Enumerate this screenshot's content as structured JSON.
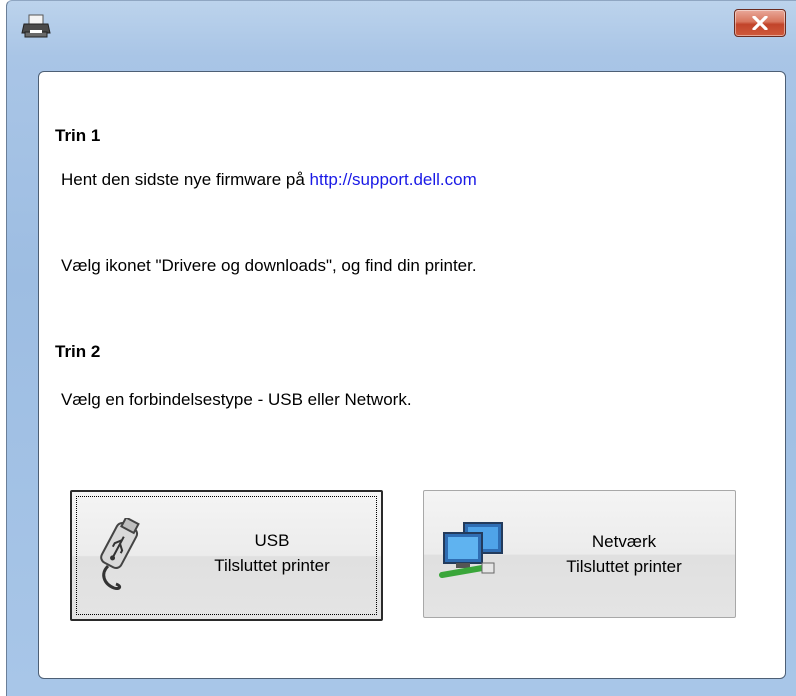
{
  "window": {
    "title": "",
    "icon": "printer-icon",
    "close_icon": "close-icon"
  },
  "step1": {
    "heading": "Trin 1",
    "text_prefix": "Hent den sidste nye firmware på ",
    "link": "http://support.dell.com",
    "instruction": "Vælg ikonet \"Drivere og downloads\", og find din printer."
  },
  "step2": {
    "heading": "Trin 2",
    "instruction": "Vælg en forbindelsestype - USB eller Network."
  },
  "buttons": {
    "usb": {
      "line1": "USB",
      "line2": "Tilsluttet printer",
      "icon": "usb-drive-icon"
    },
    "network": {
      "line1": "Netværk",
      "line2": "Tilsluttet printer",
      "icon": "network-computers-icon"
    }
  },
  "colors": {
    "link": "#1a1ae6",
    "title_bar": "#a9c5e6",
    "close_button": "#c2442a"
  }
}
